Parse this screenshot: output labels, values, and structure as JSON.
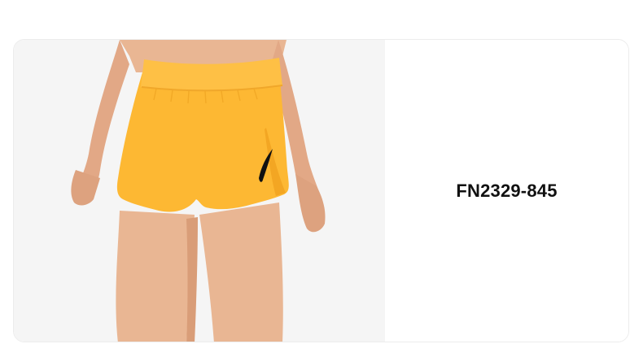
{
  "product": {
    "style_code": "FN2329-845",
    "image_icon": "running-shorts-product-photo",
    "colors": {
      "shorts": "#fdb833",
      "shorts_shadow": "#f3a623",
      "waistband": "#fec045",
      "skin": "#e9b693",
      "skin_shadow": "#d99d78",
      "swoosh": "#111111",
      "image_background": "#f5f5f5"
    }
  }
}
